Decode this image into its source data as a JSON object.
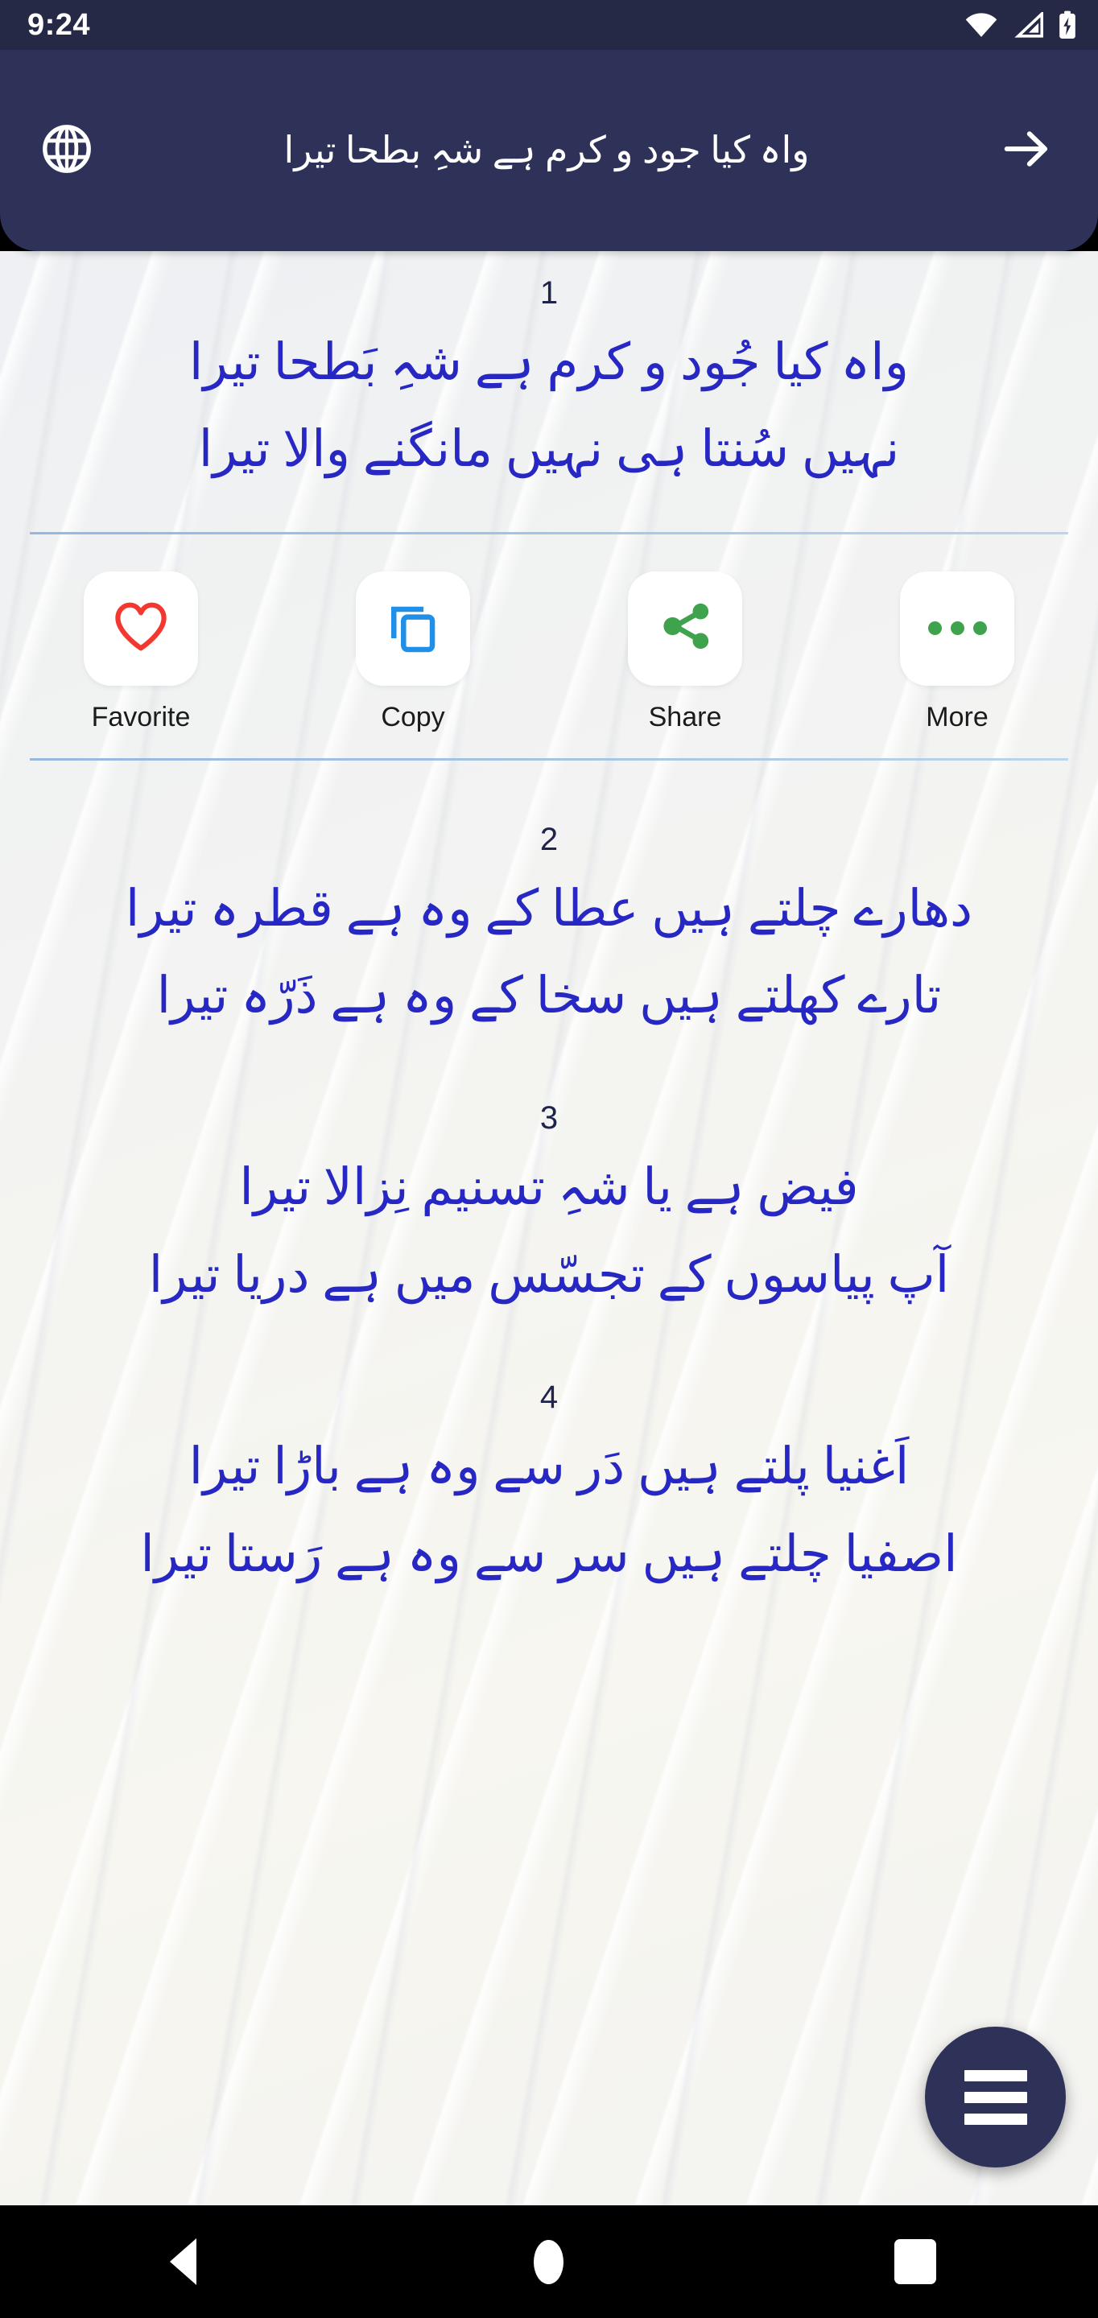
{
  "status_bar": {
    "time": "9:24",
    "icons": [
      "wifi-icon",
      "cellular-signal-icon",
      "battery-charging-icon"
    ]
  },
  "app_bar": {
    "language_icon": "globe-icon",
    "title": "واہ کیا جود و کرم ہے شہِ بطحا تیرا",
    "next_icon": "arrow-right-icon",
    "background_color": "#2e3158"
  },
  "actions": {
    "items": [
      {
        "label": "Favorite",
        "icon": "heart-icon",
        "color": "#f2382f"
      },
      {
        "label": "Copy",
        "icon": "copy-icon",
        "color": "#1f8fe8"
      },
      {
        "label": "Share",
        "icon": "share-icon",
        "color": "#3fa34d"
      },
      {
        "label": "More",
        "icon": "more-dots-icon",
        "color": "#3fa34d"
      }
    ]
  },
  "poem": {
    "text_color": "#2727c4",
    "number_color": "#20234a",
    "verses": [
      {
        "number": "1",
        "line1": "واہ کیا جُود و کرم ہے شہِ بَطحا تیرا",
        "line2": "نہیں سُنتا ہی نہیں مانگنے والا تیرا"
      },
      {
        "number": "2",
        "line1": "دھارے چلتے ہیں عطا کے وہ ہے قطرہ تیرا",
        "line2": "تارے کھلتے ہیں سخا کے وہ ہے ذَرّہ تیرا"
      },
      {
        "number": "3",
        "line1": "فیض ہے یا شہِ تسنیم نِزالا تیرا",
        "line2": "آپ پیاسوں کے تجسّس میں ہے دریا تیرا"
      },
      {
        "number": "4",
        "line1": "اَغنیا پلتے ہیں دَر سے وہ ہے باڑا تیرا",
        "line2": "اصفیا چلتے ہیں سر سے وہ ہے رَستا تیرا"
      }
    ]
  },
  "fab": {
    "icon": "hamburger-menu-icon"
  },
  "nav_bar": {
    "back": "back-triangle-icon",
    "home": "home-circle-icon",
    "recents": "recents-square-icon"
  }
}
